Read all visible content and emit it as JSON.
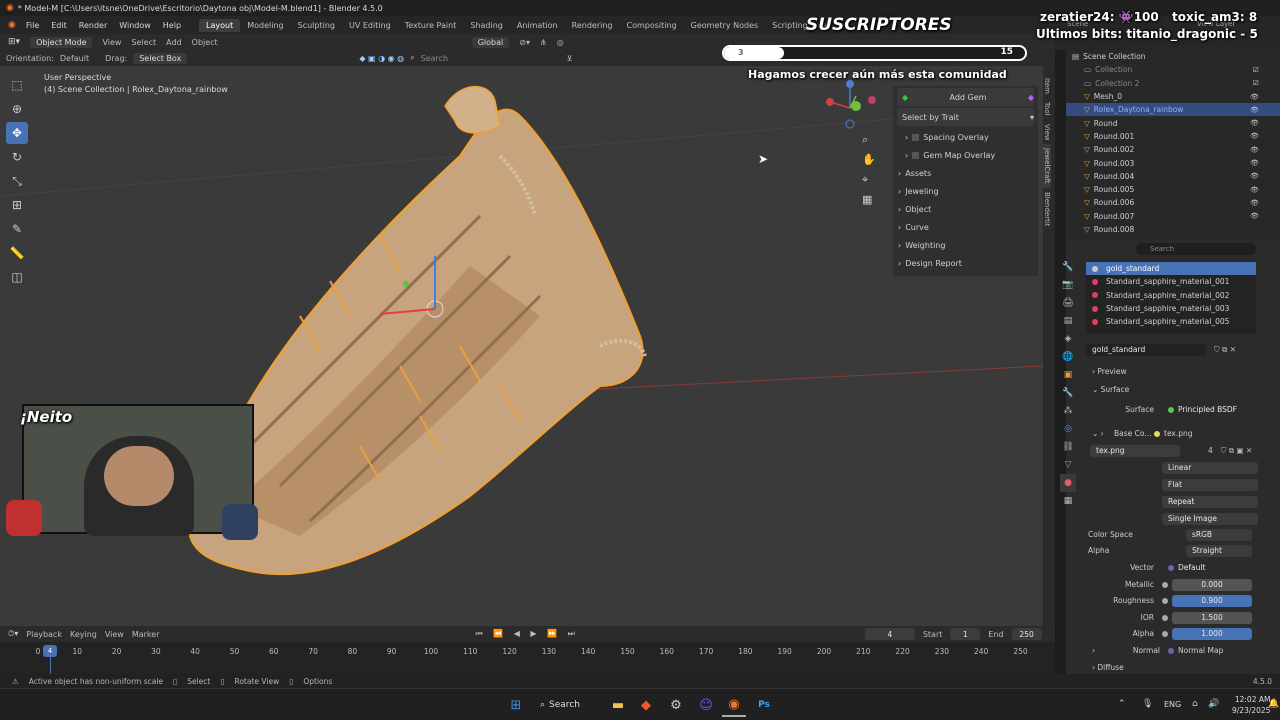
{
  "window": {
    "title": "* Model-M [C:\\Users\\itsne\\OneDrive\\Escritorio\\Daytona obj\\Model-M.blend1] - Blender 4.5.0"
  },
  "menu": [
    "File",
    "Edit",
    "Render",
    "Window",
    "Help"
  ],
  "workspaces": [
    "Layout",
    "Modeling",
    "Sculpting",
    "UV Editing",
    "Texture Paint",
    "Shading",
    "Animation",
    "Rendering",
    "Compositing",
    "Geometry Nodes",
    "Scripting"
  ],
  "header": {
    "mode": "Object Mode",
    "view": "View",
    "select": "Select",
    "add": "Add",
    "object": "Object",
    "orientation_label": "Orientation:",
    "orientation": "Default",
    "drag_label": "Drag:",
    "drag": "Select Box",
    "transform": "Global",
    "search_placeholder": "Search"
  },
  "viewport": {
    "perspective": "User Perspective",
    "collection": "(4) Scene Collection | Rolex_Daytona_rainbow"
  },
  "stream": {
    "title": "SUSCRIPTORES",
    "progress_start": "3",
    "progress_end": "15",
    "subtitle": "Hagamos crecer aún más esta comunidad",
    "user1": "zeratier24:",
    "user1_count": "100",
    "user2": "toxic_am3:",
    "user2_count": "8",
    "bits": "Ultimos bits: titanio_dragonic - 5",
    "webcam_label": "¡Neito"
  },
  "npanel": {
    "add_gem": "Add Gem",
    "select_by_trait": "Select by Trait",
    "items": [
      "Spacing Overlay",
      "Gem Map Overlay",
      "Assets",
      "Jeweling",
      "Object",
      "Curve",
      "Weighting",
      "Design Report"
    ],
    "tabs": [
      "Item",
      "Tool",
      "View",
      "JewelCraft",
      "Blendertit"
    ]
  },
  "outliner": {
    "header": "Scene Collection",
    "items": [
      "Collection",
      "Collection 2",
      "Mesh_0",
      "Rolex_Daytona_rainbow",
      "Round",
      "Round.001",
      "Round.002",
      "Round.003",
      "Round.004",
      "Round.005",
      "Round.006",
      "Round.007",
      "Round.008"
    ],
    "selected_index": 3,
    "scene_label": "Scene",
    "viewlayer_label": "View Layer"
  },
  "properties": {
    "search_placeholder": "Search",
    "materials": [
      "gold_standard",
      "Standard_sapphire_material_001",
      "Standard_sapphire_material_002",
      "Standard_sapphire_material_003",
      "Standard_sapphire_material_005"
    ],
    "material_name": "gold_standard",
    "preview": "Preview",
    "surface_section": "Surface",
    "surface_label": "Surface",
    "surface_value": "Principled BSDF",
    "base_color_label": "Base Co...",
    "base_color_value": "tex.png",
    "image_name": "tex.png",
    "image_users": "4",
    "interp": "Linear",
    "projection": "Flat",
    "extension": "Repeat",
    "source": "Single Image",
    "color_space_label": "Color Space",
    "color_space": "sRGB",
    "alpha_mode_label": "Alpha",
    "alpha_mode": "Straight",
    "vector_label": "Vector",
    "vector": "Default",
    "metallic_label": "Metallic",
    "metallic": "0.000",
    "roughness_label": "Roughness",
    "roughness": "0.900",
    "ior_label": "IOR",
    "ior": "1.500",
    "alpha_label": "Alpha",
    "alpha": "1.000",
    "normal_label": "Normal",
    "normal": "Normal Map",
    "diffuse": "Diffuse"
  },
  "timeline": {
    "playback": "Playback",
    "keying": "Keying",
    "view": "View",
    "marker": "Marker",
    "current": "4",
    "start_label": "Start",
    "start": "1",
    "end_label": "End",
    "end": "250",
    "ticks": [
      "0",
      "10",
      "20",
      "30",
      "40",
      "50",
      "60",
      "70",
      "80",
      "90",
      "100",
      "110",
      "120",
      "130",
      "140",
      "150",
      "160",
      "170",
      "180",
      "190",
      "200",
      "210",
      "220",
      "230",
      "240",
      "250"
    ]
  },
  "status": {
    "message": "Active object has non-uniform scale",
    "select": "Select",
    "rotate": "Rotate View",
    "options": "Options",
    "version": "4.5.0"
  },
  "taskbar": {
    "search": "Search",
    "lang": "ENG",
    "time": "12:02 AM",
    "date": "9/23/2025"
  },
  "colors": {
    "accent": "#4772b3",
    "selection_orange": "#f0a030",
    "gold_mesh": "#c8a47e"
  }
}
